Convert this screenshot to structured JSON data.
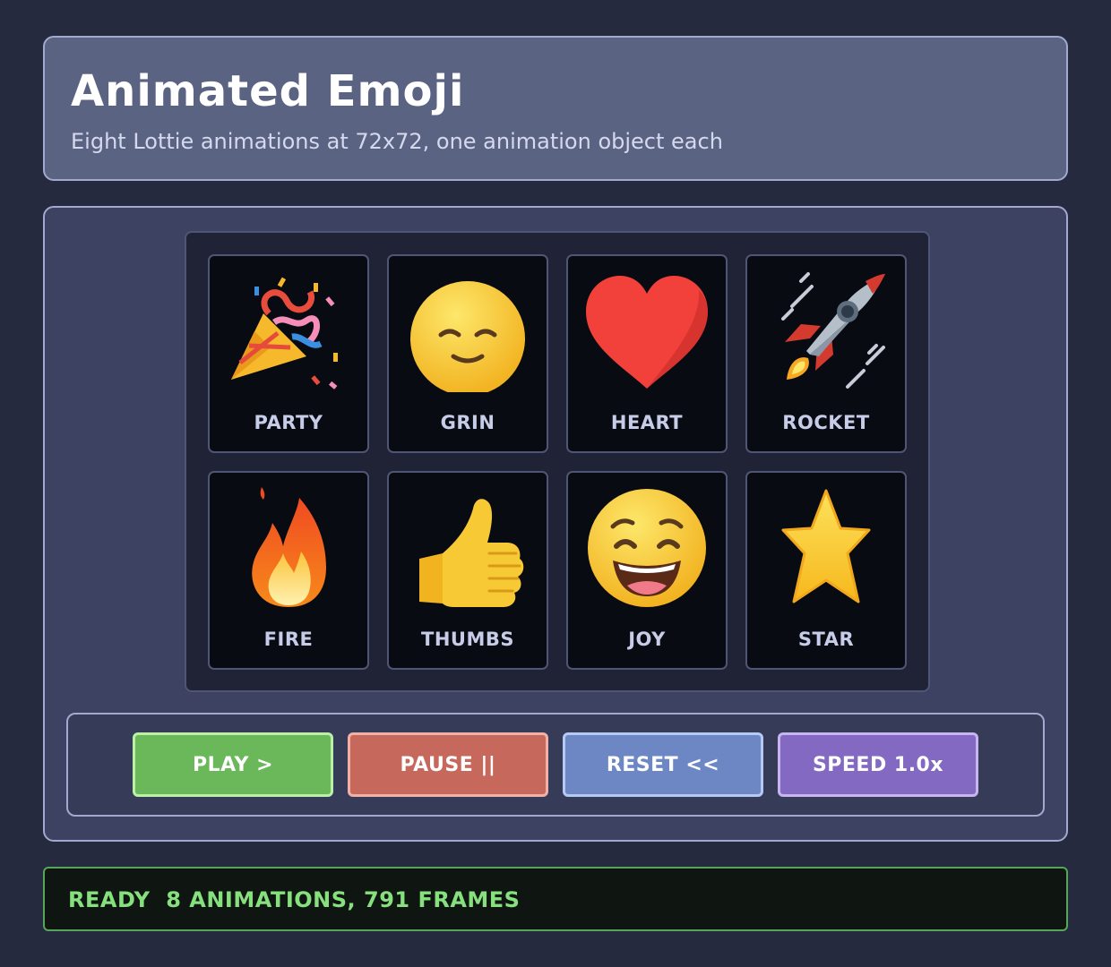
{
  "header": {
    "title": "Animated Emoji",
    "subtitle": "Eight Lottie animations at 72x72, one animation object each"
  },
  "emojis": [
    {
      "label": "PARTY",
      "icon": "party-popper-icon"
    },
    {
      "label": "GRIN",
      "icon": "smiling-face-icon"
    },
    {
      "label": "HEART",
      "icon": "red-heart-icon"
    },
    {
      "label": "ROCKET",
      "icon": "rocket-icon"
    },
    {
      "label": "FIRE",
      "icon": "fire-icon"
    },
    {
      "label": "THUMBS",
      "icon": "thumbs-up-icon"
    },
    {
      "label": "JOY",
      "icon": "grinning-face-icon"
    },
    {
      "label": "STAR",
      "icon": "star-icon"
    }
  ],
  "controls": {
    "play_label": "PLAY >",
    "pause_label": "PAUSE ||",
    "reset_label": "RESET <<",
    "speed_label": "SPEED 1.0x"
  },
  "status": {
    "text": "READY  8 ANIMATIONS, 791 FRAMES"
  },
  "colors": {
    "background": "#262a3e",
    "play": "#6ab85a",
    "pause": "#c7685d",
    "reset": "#6d87c5",
    "speed": "#8369c2",
    "status_text": "#86e07d"
  }
}
